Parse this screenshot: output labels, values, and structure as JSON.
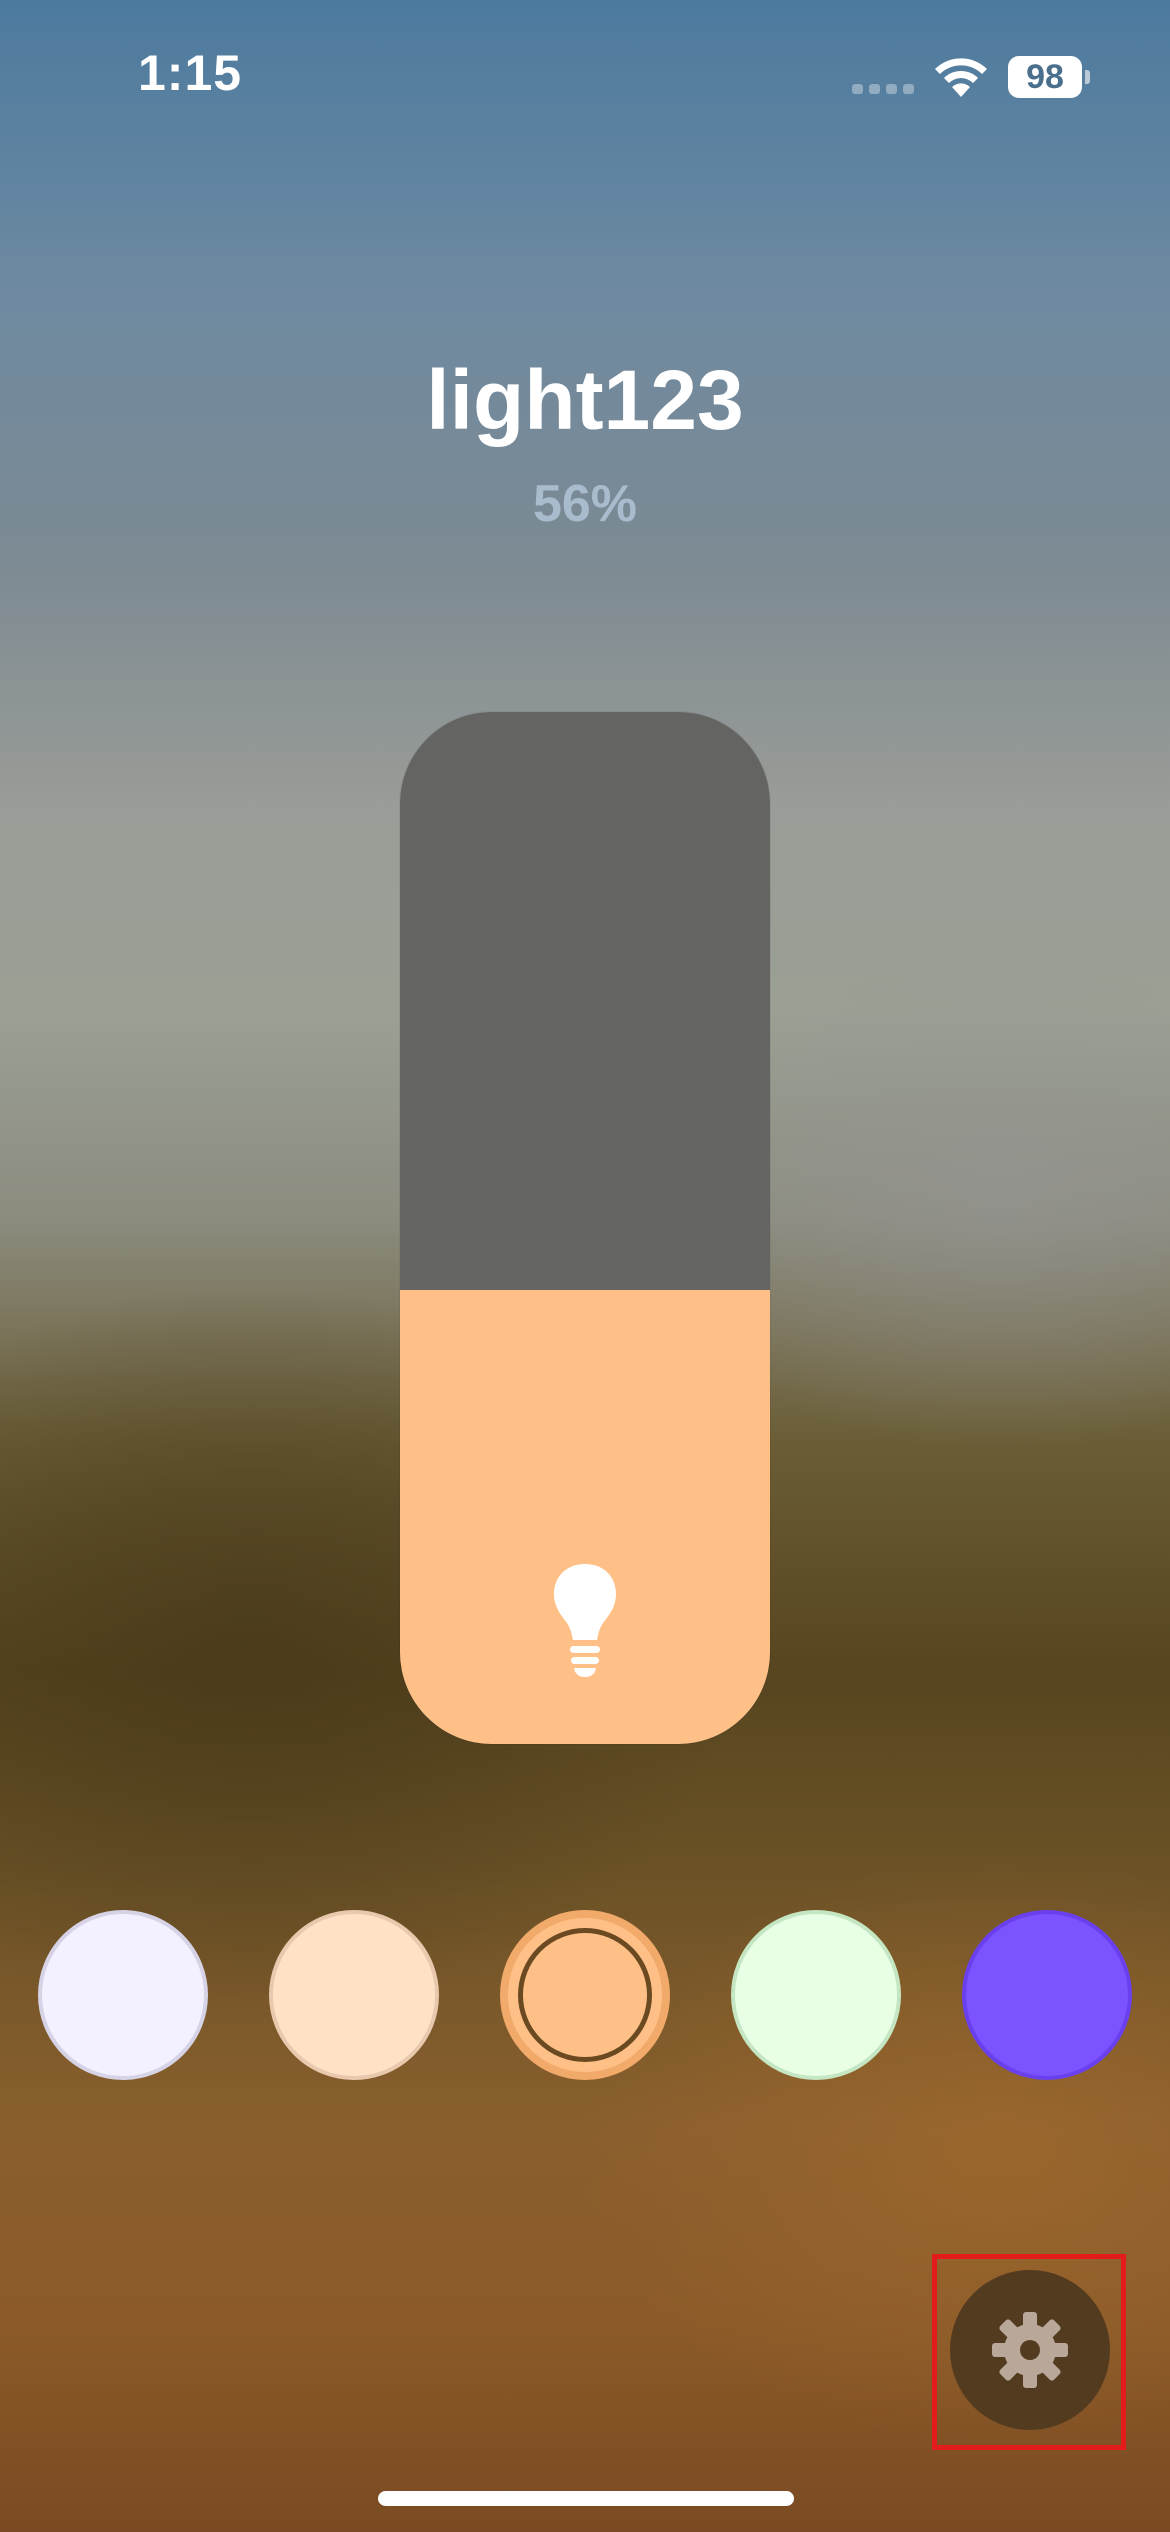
{
  "status_bar": {
    "time": "1:15",
    "battery_level": "98",
    "icons": [
      "cellular-signal-icon",
      "wifi-icon",
      "battery-icon"
    ]
  },
  "device": {
    "name": "light123",
    "brightness_label": "56%",
    "brightness_fraction": 0.44
  },
  "colors": {
    "fill": "#ffc087",
    "track": "#646562"
  },
  "color_presets": [
    {
      "name": "cool-white",
      "color": "#f3f1ff",
      "border": "#d6d3e6",
      "selected": false
    },
    {
      "name": "warm-white",
      "color": "#ffe1c5",
      "border": "#e9c9ae",
      "selected": false
    },
    {
      "name": "orange",
      "color": "#ffc087",
      "border": "#f2aa6a",
      "selected": true
    },
    {
      "name": "mint",
      "color": "#e8ffe6",
      "border": "#c5e6c3",
      "selected": false
    },
    {
      "name": "purple",
      "color": "#7b53ff",
      "border": "#6a40ee",
      "selected": false
    }
  ],
  "actions": {
    "settings_icon": "gear-icon"
  }
}
